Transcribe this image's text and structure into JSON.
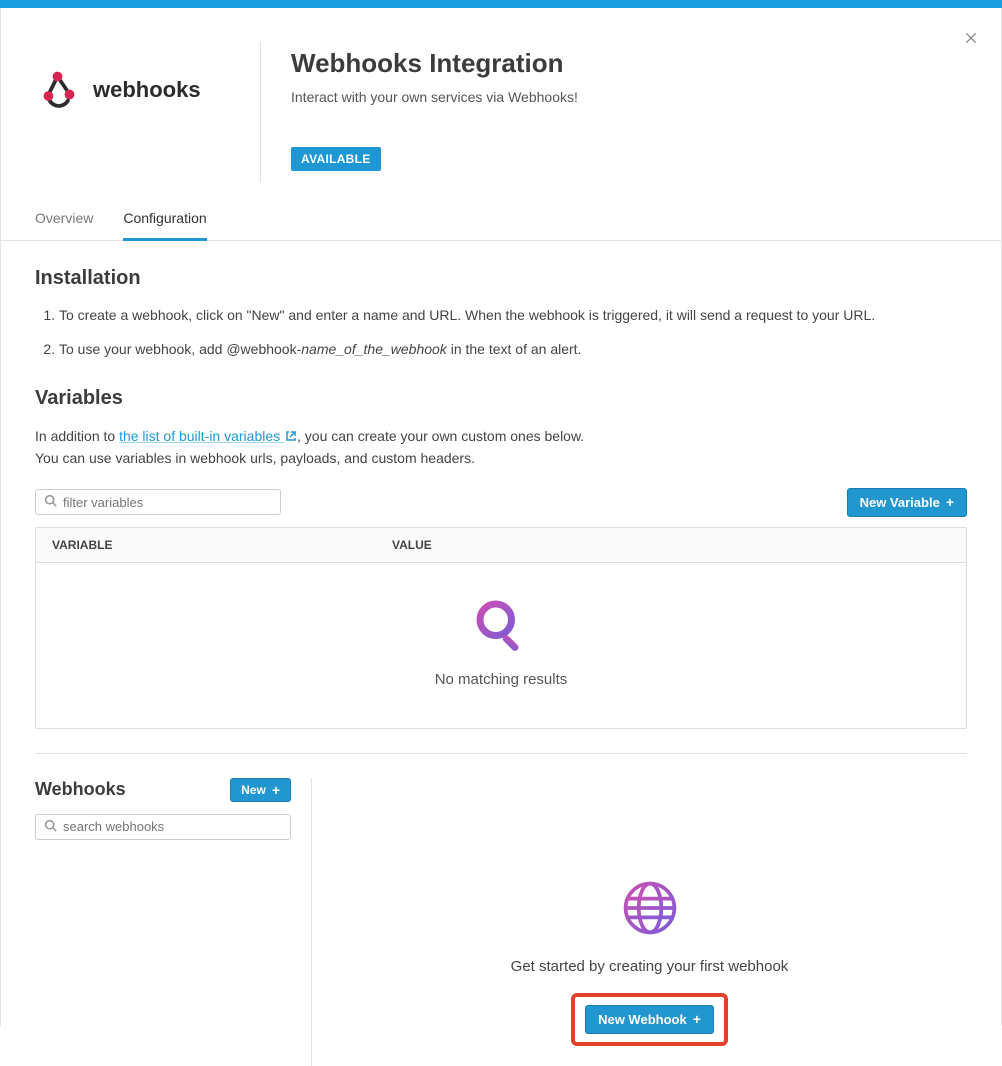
{
  "header": {
    "logo_word": "webhooks",
    "title": "Webhooks Integration",
    "subtitle": "Interact with your own services via Webhooks!",
    "badge": "AVAILABLE"
  },
  "tabs": {
    "overview": "Overview",
    "configuration": "Configuration"
  },
  "installation": {
    "heading": "Installation",
    "step1": "To create a webhook, click on \"New\" and enter a name and URL. When the webhook is triggered, it will send a request to your URL.",
    "step2_pre": "To use your webhook, add @webhook-",
    "step2_ital": "name_of_the_webhook",
    "step2_post": " in the text of an alert."
  },
  "variables": {
    "heading": "Variables",
    "intro_pre": "In addition to ",
    "intro_link": "the list of built-in variables",
    "intro_post": ", you can create your own custom ones below.",
    "intro_line2": "You can use variables in webhook urls, payloads, and custom headers.",
    "filter_placeholder": "filter variables",
    "new_variable_label": "New Variable",
    "col_variable": "VARIABLE",
    "col_value": "VALUE",
    "empty_msg": "No matching results"
  },
  "webhooks": {
    "heading": "Webhooks",
    "new_label": "New",
    "search_placeholder": "search webhooks",
    "getstarted": "Get started by creating your first webhook",
    "new_webhook_label": "New Webhook"
  }
}
